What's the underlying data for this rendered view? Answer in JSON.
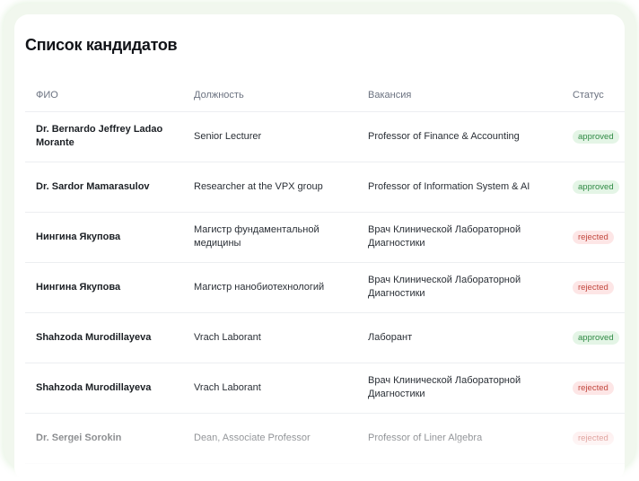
{
  "page": {
    "title": "Список кандидатов"
  },
  "table": {
    "columns": {
      "name": "ФИО",
      "position": "Должность",
      "vacancy": "Вакансия",
      "status": "Статус"
    },
    "rows": [
      {
        "name": "Dr. Bernardo Jeffrey Ladao Morante",
        "position": "Senior Lecturer",
        "vacancy": "Professor of Finance & Accounting",
        "status": "approved"
      },
      {
        "name": "Dr. Sardor Mamarasulov",
        "position": "Researcher at the VPX group",
        "vacancy": "Professor of Information System & AI",
        "status": "approved"
      },
      {
        "name": "Нингина Якупова",
        "position": "Магистр фундаментальной медицины",
        "vacancy": "Врач Клинической Лабораторной Диагностики",
        "status": "rejected"
      },
      {
        "name": "Нингина Якупова",
        "position": "Магистр нанобиотехнологий",
        "vacancy": "Врач Клинической Лабораторной Диагностики",
        "status": "rejected"
      },
      {
        "name": "Shahzoda Murodillayeva",
        "position": "Vrach Laborant",
        "vacancy": "Лаборант",
        "status": "approved"
      },
      {
        "name": "Shahzoda Murodillayeva",
        "position": "Vrach Laborant",
        "vacancy": "Врач Клинической Лабораторной Диагностики",
        "status": "rejected"
      },
      {
        "name": "Dr. Sergei Sorokin",
        "position": "Dean, Associate Professor",
        "vacancy": "Professor of Liner Algebra",
        "status": "rejected"
      }
    ]
  },
  "colors": {
    "approved_bg": "#e4f5e6",
    "approved_text": "#2f8a44",
    "rejected_bg": "#fde6e6",
    "rejected_text": "#c2483f",
    "outer_glow": "#f1f7ee"
  }
}
